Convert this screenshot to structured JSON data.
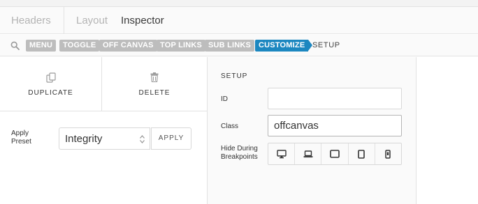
{
  "tabs": [
    {
      "label": "Headers"
    },
    {
      "label": "Layout"
    },
    {
      "label": "Inspector"
    }
  ],
  "breadcrumbs": [
    {
      "label": "MENU"
    },
    {
      "label": "TOGGLE"
    },
    {
      "label": "OFF CANVAS"
    },
    {
      "label": "TOP LINKS"
    },
    {
      "label": "SUB LINKS"
    },
    {
      "label": "CUSTOMIZE"
    },
    {
      "label": "SETUP"
    }
  ],
  "actions": {
    "duplicate_label": "DUPLICATE",
    "delete_label": "DELETE"
  },
  "preset": {
    "label": "Apply Preset",
    "selected": "Integrity",
    "apply_label": "APPLY"
  },
  "setup": {
    "title": "SETUP",
    "id_label": "ID",
    "id_value": "",
    "class_label": "Class",
    "class_value": "offcanvas",
    "breakpoints_label": "Hide During Breakpoints",
    "breakpoints": [
      {
        "icon": "desktop-icon"
      },
      {
        "icon": "laptop-icon"
      },
      {
        "icon": "tablet-landscape-icon"
      },
      {
        "icon": "tablet-portrait-icon"
      },
      {
        "icon": "phone-icon"
      }
    ]
  },
  "colors": {
    "accent": "#1c87c0",
    "crumb_inactive": "#bdbdbd"
  }
}
